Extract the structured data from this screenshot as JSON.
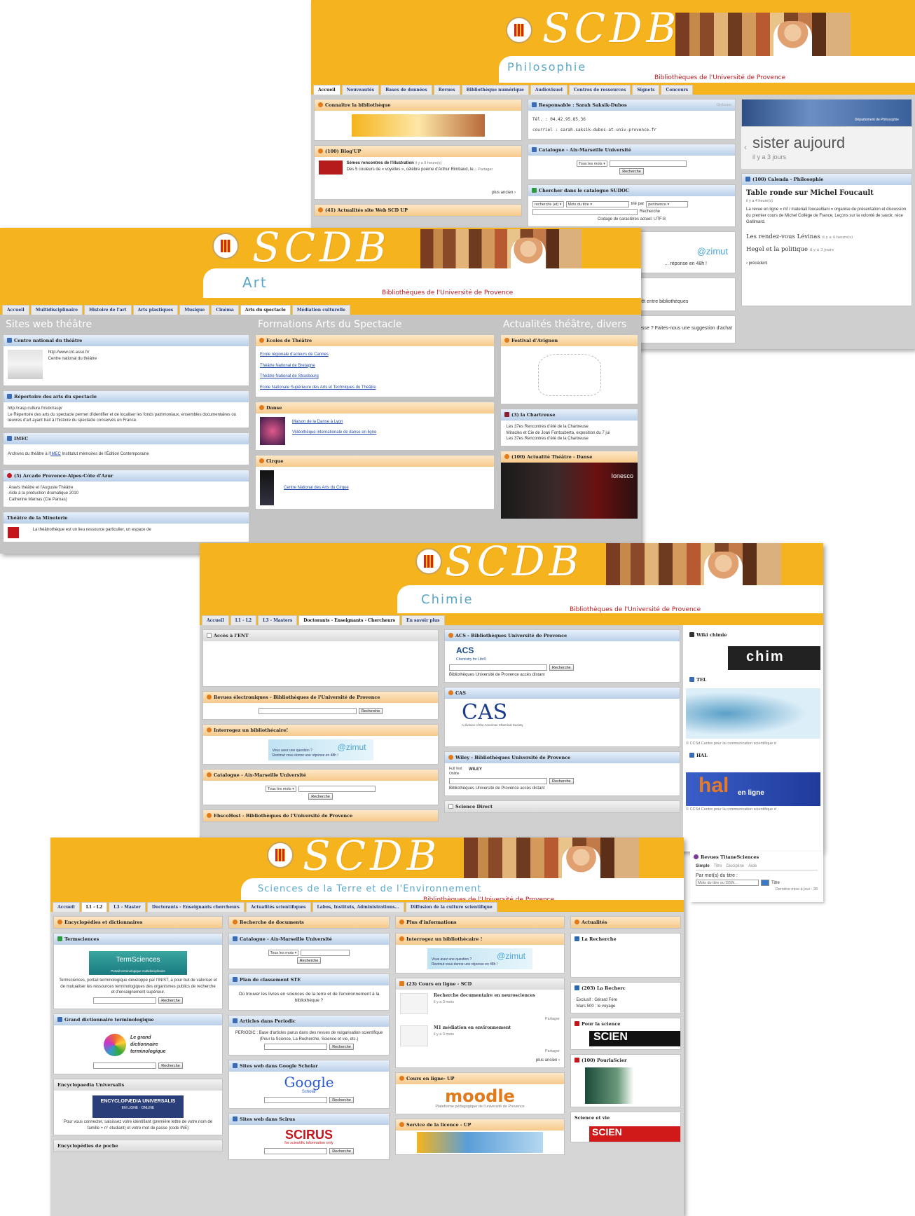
{
  "colors": {
    "banner": "#f5b41d",
    "subtitle": "#5aa7c9",
    "org": "#c4161c",
    "link": "#2247a8"
  },
  "logo_text": "SCDB",
  "philosophie": {
    "subtitle": "Philosophie",
    "org": "Bibliothèques de l'Université de Provence",
    "tabs": [
      "Accueil",
      "Nouveautés",
      "Bases de données",
      "Revues",
      "Bibliothèque numérique",
      "Audiovisuel",
      "Centres de ressources",
      "Signets",
      "Concours"
    ],
    "g1_title": "Connaître la bibliothèque",
    "g2_title": "(100) Blog'UP",
    "g2_item": "Sèmes rencontres de l'illustration",
    "g2_meta": "il y a 9 heure(s)",
    "g2_text": "Des 5 couleurs de « voyelles », célèbre poème d'Arthur Rimbaud, le...",
    "g2_partager": "Partager",
    "g2_more": "plus ancien ›",
    "g3_title": "(41) Actualités site Web SCD UP",
    "g4_title": "Responsable : Sarah Saksik-Dubos",
    "g4_options": "Options",
    "tel": "Tél. : 04.42.95.85.36",
    "courriel": "courriel : sarah.saksik-dubos-at-univ-provence.fr",
    "g5_title": "Catalogue - Aix-Marseille Université",
    "tous": "Tous les mots",
    "recherche": "Recherche",
    "g6_title": "Chercher dans le catalogue SUDOC",
    "sudoc_sel1": "recherche (et)",
    "sudoc_sel2": "Mots du titre",
    "trie": "trié par",
    "pertinence": "pertinence",
    "codage": "Codage de caractères actuel: UTF-8",
    "zimut": "@zimut",
    "zim_text": "... réponse en 48h !",
    "pret": "... le prêt entre bibliothèques",
    "suggestion": "... vous intéresse ? Faites-nous une suggestion d'achat",
    "dept": "Département de Philosophie",
    "big": "sister aujourd",
    "big_meta": "il y a 3 jours",
    "calenda": "(100) Calenda - Philosophie",
    "table_ronde": "Table ronde sur Michel Foucault",
    "table_ronde_meta": "il y a 4 heure(s)",
    "table_ronde_text": "La revue en ligne « mf / materiali foucaultiani » organise de présentation et discussion du premier cours de Michel Collège de France, Leçons sur la volonté de savoir, réce Gallimard.",
    "levinas": "Les rendez-vous Lévinas",
    "levinas_meta": "il y a 4 heure(s)",
    "hegel": "Hegel et la politique",
    "hegel_meta": "il y a 3 jours",
    "precedent": "‹ précédent"
  },
  "art": {
    "subtitle": "Art",
    "org": "Bibliothèques de l'Université de Provence",
    "tabs": [
      "Accueil",
      "Multidisciplinaire",
      "Histoire de l'art",
      "Arts plastiques",
      "Musique",
      "Cinéma",
      "Arts du spectacle",
      "Médiation culturelle"
    ],
    "col1": "Sites web théâtre",
    "col2": "Formations Arts du Spectacle",
    "col3": "Actualités théâtre, divers",
    "cnt_title": "Centre national du théâtre",
    "cnt_url": "http://www.cnt.asso.fr/",
    "cnt_name": "Centre national du théâtre",
    "rasp_title": "Répertoire des arts du spectacle",
    "rasp_url": "http://rasp.culture.fr/sdx/rasp/",
    "rasp_text": "Le Répertoire des arts du spectacle permet d'identifier et de localiser les fonds patrimoniaux, ensembles documentaires ou œuvres d'art ayant trait à l'histoire du spectacle conservés en France.",
    "imec_title": "IMEC",
    "imec_text_a": "Archives du théâtre à l'",
    "imec_link": "IMEC",
    "imec_text_b": " Institutut mémoires de l'Édition Contemporaine",
    "arcade_title": "(5) Arcade Provence-Alpes-Côte d'Azur",
    "arcade_items": [
      "Aravis théâtre et l'Auguste Théâtre",
      "Aide à la production dramatique 2010",
      "Catherine Marnas (Cie Parnas)"
    ],
    "minoterie_title": "Théâtre de la Minoterie",
    "minoterie_text": "La théâtrothèque est un lieu ressource particulier, un espace de",
    "ecoles_title": "Ecoles de Théâtre",
    "ecoles": [
      "Ecole régionale d'acteurs de Cannes",
      "Théâtre National de Bretagne",
      "Théâtre National de Strasbourg",
      "Ecole Nationale Supérieure des Arts et Techniques du Théâtre"
    ],
    "danse_title": "Danse",
    "danse": [
      "Maison de la Danse à Lyon",
      "Vidéothèque internationale de danse en ligne"
    ],
    "cirque_title": "Cirque",
    "cirque": [
      "Centre National des Arts du Cirque"
    ],
    "avignon_title": "Festival d'Avignon",
    "chartreuse_title": "(3) la Chartreuse",
    "chartreuse": [
      "Les 37es Rencontres d'été de la Chartreuse",
      "Miracles et Cie de Joan Fontcuberta, exposition du 7 jui",
      "Les 37es Rencontres d'été de la Chartreuse"
    ],
    "actu_title": "(100) Actualité Théâtre - Danse",
    "ionesco": "Ionesco"
  },
  "chimie": {
    "subtitle": "Chimie",
    "org": "Bibliothèques de l'Université de Provence",
    "tabs": [
      "Accueil",
      "L1 - L2",
      "L3 - Masters",
      "Doctorants - Enseignants - Chercheurs",
      "En savoir plus"
    ],
    "ent": "Accès à l'ENT",
    "revues": "Revues électroniques - Bibliothèques de l'Université de Provence",
    "interrogez": "Interrogez un bibliothécaire!",
    "zim_q": "Vous avez une question ?",
    "zim_a": "Rezimut vous donne une réponse en 48h !",
    "catalogue": "Catalogue - Aix-Marseille Université",
    "ebsco": "EbscoHost - Bibliothèques de l'Université de Provence",
    "acs_title": "ACS - Bibliothèques Université de Provence",
    "acs_logo": "ACS",
    "acs_tag": "Chemistry for Life®",
    "acces_distant": "Bibliothèques Université de Provence accès distant",
    "cas_title": "CAS",
    "cas_logo": "CAS",
    "cas_tag": "A division of the American Chemical Society",
    "wiley_title": "Wiley - Bibliothèques Université de Provence",
    "wiley_full": "Full Text Online",
    "wiley_logo": "WILEY",
    "sd_title": "Science Direct",
    "wiki_title": "Wiki chimie",
    "wiki_logo": "chim",
    "tel_title": "TEL",
    "ccsd": "© CCSd Centre pour la communication scientifique d",
    "hal_title": "HAL",
    "hal_logo": "hal",
    "hal_sub": "en ligne",
    "titane_title": "Revues TitaneSciences",
    "titane_tabs": [
      "Simple",
      "Titre",
      "Discipline",
      "Aide"
    ],
    "titane_label": "Par mot(s) du titre :",
    "titane_ph": "Mots du titre ou ISSN...",
    "titane_go": "Titre",
    "titane_maj": "Dernière mise à jour : 28"
  },
  "ste": {
    "subtitle": "Sciences de la Terre et de l'Environnement",
    "org": "Bibliothèques de l'Université de Provence",
    "tabs": [
      "Accueil",
      "L1 - L2",
      "L3 - Master",
      "Doctorants - Enseignants chercheurs",
      "Actualités scientifiques",
      "Labos, Instituts, Administrations...",
      "Diffusion de la culture scientifique"
    ],
    "c1": "Encyclopédies et dictionnaires",
    "termsci_title": "Termsciences",
    "termsci_logo": "TermSciences",
    "termsci_tag": "Portail terminologique multidisciplinaire",
    "termsci_text": "Termsciences, portail terminologique développé par l'INIST, a pour but de valoriser et de mutualiser les ressources terminologiques des organismes publics de recherche et d'enseignement supérieur.",
    "gdt_title": "Grand dictionnaire terminologique",
    "gdt_logo": "Le grand dictionnaire terminologique",
    "eu_title": "Encyclopaedia Universalis",
    "eu_logo": "ENCYCLOPÆDIA UNIVERSALIS",
    "eu_tag": "EN LIGNE · ONLINE",
    "eu_text": "Pour vous connecter, saisissez votre identifiant (première lettre de votre nom de famille + n° étudiant) et votre mot de passe (code INE)",
    "poche_title": "Encyclopédies de poche",
    "c2": "Recherche de documents",
    "cat_title": "Catalogue - Aix-Marseille Université",
    "plan_title": "Plan de classement STE",
    "plan_text": "Où trouver les livres en sciences de la terre et de l'environnement à la bibliothèque ?",
    "periodic_title": "Articles dans Periodic",
    "periodic_text": "PERIODIC : Base d'articles parus dans des revues de vulgarisation scientifique (Pour la Science, La Recherche, Science et vie, etc.)",
    "scholar_title": "Sites web dans Google Scholar",
    "scholar_logo": "Google",
    "scholar_sub": "Scholar",
    "scirus_title": "Sites web dans Scirus",
    "scirus_logo": "SCIRUS",
    "scirus_sub": "for scientific information only",
    "c3": "Plus d'informations",
    "interrogez": "Interrogez un bibliothécaire !",
    "cours_title": "(23) Cours en ligne - SCD",
    "cours1": "Recherche documentaire en neurosciences",
    "cours1_meta": "il y a 3 mois",
    "cours2": "M1 médiation en environnement",
    "cours2_meta": "il y a 3 mois",
    "partager": "Partager",
    "plus_ancien": "plus ancien ›",
    "moodle_title": "Cours en ligne- UP",
    "moodle_logo": "moodle",
    "moodle_text": "Plateforme pédagogique de l'université de Provence",
    "licence_title": "Service de la licence - UP",
    "c4": "Actualités",
    "recherche_title": "La Recherche",
    "recherche2_title": "(203) La Recherc",
    "recherche_items": [
      "Exclusif : Gérard Fére",
      "Mars 500 : le voyage"
    ],
    "pls_title": "Pour la science",
    "pls2_title": "(100) PourlaScier",
    "sev_title": "Science et vie",
    "scien": "SCIEN"
  }
}
